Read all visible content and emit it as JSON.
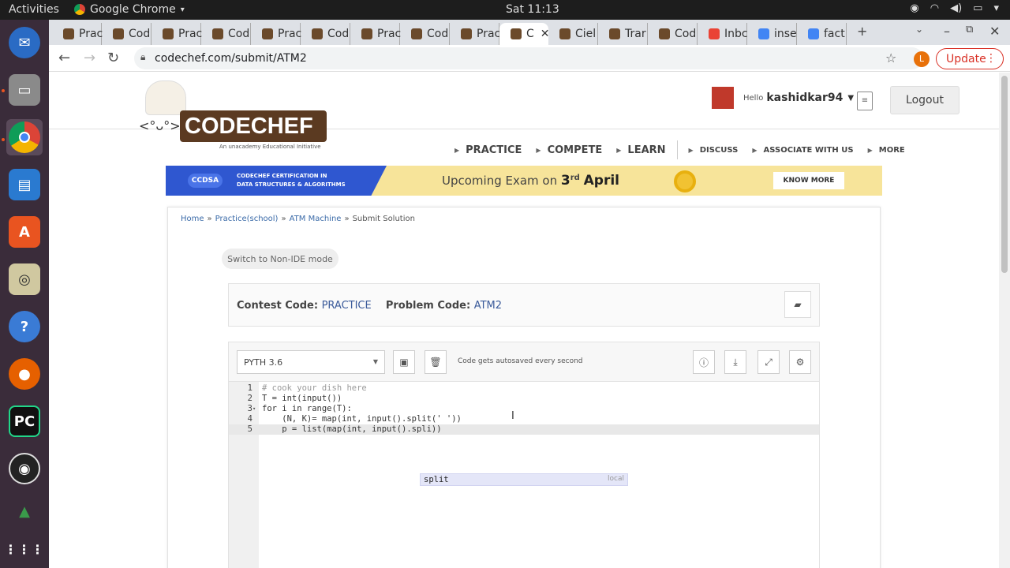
{
  "topbar": {
    "activities": "Activities",
    "app": "Google Chrome",
    "app_caret": "▾",
    "clock": "Sat 11:13"
  },
  "dock": {
    "items": [
      "thunderbird",
      "files",
      "chrome",
      "writer",
      "software",
      "rhythmbox",
      "help",
      "firefox",
      "pycharm",
      "obs",
      "other",
      "apps"
    ]
  },
  "tabs": [
    {
      "label": "Prac"
    },
    {
      "label": "Cod"
    },
    {
      "label": "Prac"
    },
    {
      "label": "Cod"
    },
    {
      "label": "Prac"
    },
    {
      "label": "Cod"
    },
    {
      "label": "Prac"
    },
    {
      "label": "Cod"
    },
    {
      "label": "Prac"
    },
    {
      "label": "C",
      "active": true
    },
    {
      "label": "Ciel"
    },
    {
      "label": "Trar"
    },
    {
      "label": "Cod"
    },
    {
      "label": "Inbc"
    },
    {
      "label": "inse"
    },
    {
      "label": "fact"
    }
  ],
  "tab_close": "✕",
  "tab_new": "+",
  "omnibar": {
    "url": "codechef.com/submit/ATM2",
    "profile_initial": "L",
    "update": "Update"
  },
  "header": {
    "logo_text": "CODECHEF",
    "tagline": "An unacademy Educational Initiative",
    "hello": "Hello",
    "username": "kashidkar94",
    "logout": "Logout"
  },
  "menu": [
    {
      "label": "PRACTICE",
      "small": false
    },
    {
      "label": "COMPETE",
      "small": false
    },
    {
      "label": "LEARN",
      "small": false
    },
    {
      "label": "DISCUSS",
      "small": true
    },
    {
      "label": "ASSOCIATE WITH US",
      "small": true
    },
    {
      "label": "MORE",
      "small": true
    }
  ],
  "banner": {
    "badge": "CCDSA",
    "cert_line1": "CODECHEF CERTIFICATION IN",
    "cert_line2": "DATA STRUCTURES & ALGORITHMS",
    "exam_prefix": "Upcoming Exam on",
    "exam_day": "3",
    "exam_sup": "rd",
    "exam_month": "April",
    "cta": "KNOW MORE"
  },
  "breadcrumb": {
    "home": "Home",
    "sep": "»",
    "practice": "Practice(school)",
    "problem": "ATM Machine",
    "current": "Submit Solution"
  },
  "switch_mode": "Switch to Non-IDE mode",
  "codes": {
    "contest_label": "Contest Code:",
    "contest_value": "PRACTICE",
    "problem_label": "Problem Code:",
    "problem_value": "ATM2"
  },
  "editor": {
    "language": "PYTH 3.6",
    "autosave": "Code gets autosaved every second",
    "lines": [
      {
        "n": "1",
        "text": "# cook your dish here"
      },
      {
        "n": "2",
        "text": "T = int(input())"
      },
      {
        "n": "3",
        "text": "for i in range(T):",
        "fold": "▾"
      },
      {
        "n": "4",
        "text": "    (N, K)= map(int, input().split(' '))"
      },
      {
        "n": "5",
        "text": "    p = list(map(int, input().spli))"
      }
    ],
    "autocomplete": {
      "word": "split",
      "meta": "local"
    }
  }
}
